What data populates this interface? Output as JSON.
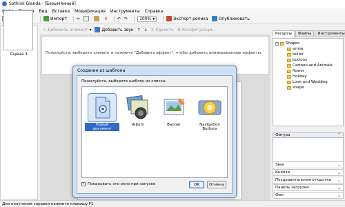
{
  "window": {
    "title": "Sothink Glanda - [Безымянный]"
  },
  "menu": [
    "Файл",
    "Правка",
    "Вид",
    "Вставка",
    "Модификация",
    "Инструменты",
    "Справка"
  ],
  "toolbar": {
    "import_label": "Импорт",
    "zoom": "100%",
    "export_label": "Экспорт ролика",
    "publish_label": "Опубликовать"
  },
  "toolbar2": {
    "add_element": "Добавить элемент",
    "add_sound": "Добавить звук",
    "delete": "Удалить",
    "configuration": "Конфигураци..."
  },
  "scenes": {
    "scene_label": "Сцена 1"
  },
  "hint": "Пожалуйста, выберите элемент и нажмите \"Добавить эффект\", чтобы добавить анимированные эффекты.",
  "right_panel": {
    "tabs": [
      "Ресурсы",
      "Файлы",
      "Инструменты"
    ],
    "tree_root": "Shapes",
    "tree_items": [
      "arrow",
      "bullet",
      "buttons",
      "Cartoon and Animals",
      "flower",
      "Holiday",
      "Love and Wedding",
      "shape"
    ],
    "properties_header": "Фигура",
    "sections": [
      "Звук",
      "Кнопка",
      "Поздравительная открытка",
      "Панель загрузки",
      "Фон"
    ]
  },
  "status": "Для получения справки нажмите клавишу F1",
  "dialog": {
    "title": "Создание из шаблона",
    "prompt": "Пожалуйста, выберите шаблон из списка:",
    "templates": [
      "Новый документ",
      "Album",
      "Banner",
      "Navigation Buttons"
    ],
    "checkbox_label": "Показывать это окно при запуске",
    "checkbox_checked": true,
    "ok_label": "OK",
    "cancel_label": "Отмена"
  }
}
